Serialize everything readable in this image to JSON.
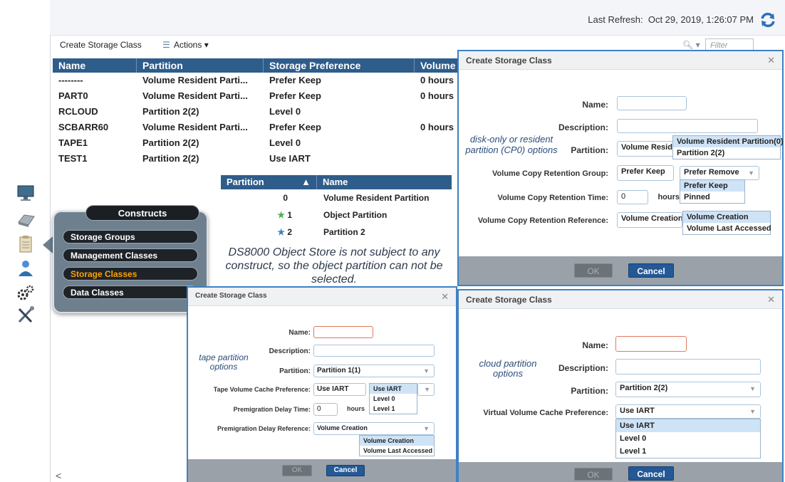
{
  "header": {
    "refresh_label": "Last Refresh:",
    "refresh_time": "Oct 29, 2019, 1:26:07 PM"
  },
  "toolbar": {
    "create_label": "Create Storage Class",
    "actions_label": "Actions",
    "filter_placeholder": "Filter"
  },
  "table": {
    "columns": [
      "Name",
      "Partition",
      "Storage Preference",
      "Volume"
    ],
    "rows": [
      [
        "--------",
        "Volume Resident Parti...",
        "Prefer Keep",
        "0 hours"
      ],
      [
        "PART0",
        "Volume Resident Parti...",
        "Prefer Keep",
        "0 hours"
      ],
      [
        "RCLOUD",
        "Partition 2(2)",
        "Level 0",
        ""
      ],
      [
        "SCBARR60",
        "Volume Resident Parti...",
        "Prefer Keep",
        "0 hours"
      ],
      [
        "TAPE1",
        "Partition 2(2)",
        "Level 0",
        ""
      ],
      [
        "TEST1",
        "Partition 2(2)",
        "Use IART",
        ""
      ]
    ]
  },
  "partition_table": {
    "columns": [
      "Partition",
      "Name"
    ],
    "rows": [
      [
        "0",
        "Volume Resident Partition"
      ],
      [
        "1",
        "Object Partition"
      ],
      [
        "2",
        "Partition 2"
      ]
    ]
  },
  "constructs": {
    "title": "Constructs",
    "items": [
      "Storage Groups",
      "Management Classes",
      "Storage Classes",
      "Data Classes"
    ]
  },
  "note": "DS8000 Object Store is not subject to any construct, so the object partition can not be selected.",
  "dialog_top": {
    "title": "Create Storage Class",
    "annotation": "disk-only or resident partition (CP0) options",
    "name_label": "Name:",
    "description_label": "Description:",
    "partition_label": "Partition:",
    "partition_value": "Volume Reside",
    "partition_options": [
      "Volume Resident Partition(0)",
      "Partition 2(2)"
    ],
    "retention_group_label": "Volume Copy Retention Group:",
    "retention_group_value": "Prefer Keep",
    "retention_group_options": [
      "Prefer Remove",
      "Prefer Keep",
      "Pinned"
    ],
    "retention_time_label": "Volume Copy Retention Time:",
    "retention_time_value": "0",
    "hours": "hours",
    "retention_ref_label": "Volume Copy Retention Reference:",
    "retention_ref_value": "Volume Creation",
    "retention_ref_options": [
      "Volume Creation",
      "Volume Last Accessed"
    ],
    "ok": "OK",
    "cancel": "Cancel"
  },
  "dialog_tape": {
    "title": "Create Storage Class",
    "annotation": "tape partition options",
    "name_label": "Name:",
    "description_label": "Description:",
    "partition_label": "Partition:",
    "partition_value": "Partition 1(1)",
    "cache_pref_label": "Tape Volume Cache Preference:",
    "cache_pref_value": "Use IART",
    "cache_pref_options": [
      "Use IART",
      "Level 0",
      "Level 1"
    ],
    "delay_time_label": "Premigration Delay Time:",
    "delay_time_value": "0",
    "hours": "hours",
    "delay_ref_label": "Premigration Delay Reference:",
    "delay_ref_value": "Volume Creation",
    "delay_ref_options": [
      "Volume Creation",
      "Volume Last Accessed"
    ],
    "ok": "OK",
    "cancel": "Cancel"
  },
  "dialog_cloud": {
    "title": "Create Storage Class",
    "annotation": "cloud partition options",
    "name_label": "Name:",
    "description_label": "Description:",
    "partition_label": "Partition:",
    "partition_value": "Partition 2(2)",
    "cache_pref_label": "Virtual Volume Cache Preference:",
    "cache_pref_value": "Use IART",
    "cache_pref_options": [
      "Use IART",
      "Level 0",
      "Level 1"
    ],
    "ok": "OK",
    "cancel": "Cancel"
  },
  "colors": {
    "header_blue": "#2f5d8b",
    "dialog_border": "#3d82c4",
    "active_item": "#ffa200"
  }
}
